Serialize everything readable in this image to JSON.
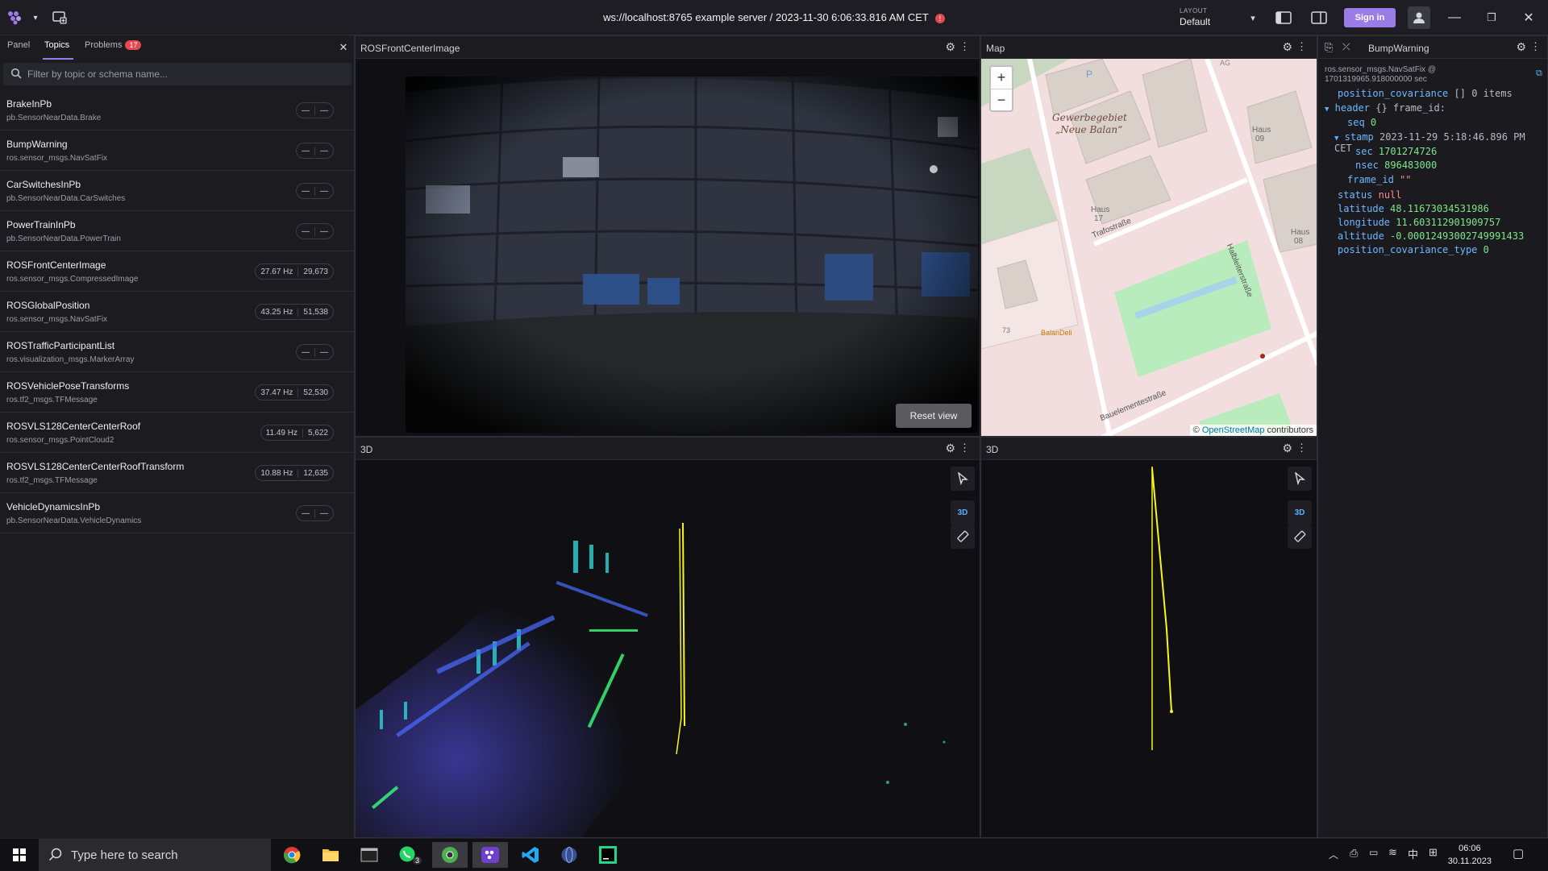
{
  "app": {
    "title": "ws://localhost:8765 example server / 2023-11-30 6:06:33.816 AM CET",
    "error_indicator": "!",
    "layout_label": "LAYOUT",
    "layout_value": "Default",
    "signin_label": "Sign in"
  },
  "sidebar": {
    "tabs": [
      {
        "label": "Panel"
      },
      {
        "label": "Topics"
      },
      {
        "label": "Problems",
        "badge": "17"
      }
    ],
    "filter_placeholder": "Filter by topic or schema name...",
    "topics": [
      {
        "name": "BrakeInPb",
        "schema": "pb.SensorNearData.Brake",
        "hz": "—",
        "count": "—"
      },
      {
        "name": "BumpWarning",
        "schema": "ros.sensor_msgs.NavSatFix",
        "hz": "—",
        "count": "—"
      },
      {
        "name": "CarSwitchesInPb",
        "schema": "pb.SensorNearData.CarSwitches",
        "hz": "—",
        "count": "—"
      },
      {
        "name": "PowerTrainInPb",
        "schema": "pb.SensorNearData.PowerTrain",
        "hz": "—",
        "count": "—"
      },
      {
        "name": "ROSFrontCenterImage",
        "schema": "ros.sensor_msgs.CompressedImage",
        "hz": "27.67 Hz",
        "count": "29,673"
      },
      {
        "name": "ROSGlobalPosition",
        "schema": "ros.sensor_msgs.NavSatFix",
        "hz": "43.25 Hz",
        "count": "51,538"
      },
      {
        "name": "ROSTrafficParticipantList",
        "schema": "ros.visualization_msgs.MarkerArray",
        "hz": "—",
        "count": "—"
      },
      {
        "name": "ROSVehiclePoseTransforms",
        "schema": "ros.tf2_msgs.TFMessage",
        "hz": "37.47 Hz",
        "count": "52,530"
      },
      {
        "name": "ROSVLS128CenterCenterRoof",
        "schema": "ros.sensor_msgs.PointCloud2",
        "hz": "11.49 Hz",
        "count": "5,622"
      },
      {
        "name": "ROSVLS128CenterCenterRoofTransform",
        "schema": "ros.tf2_msgs.TFMessage",
        "hz": "10.88 Hz",
        "count": "12,635"
      },
      {
        "name": "VehicleDynamicsInPb",
        "schema": "pb.SensorNearData.VehicleDynamics",
        "hz": "—",
        "count": "—"
      }
    ]
  },
  "panels": {
    "image": {
      "title": "ROSFrontCenterImage",
      "reset_label": "Reset view"
    },
    "map": {
      "title": "Map",
      "zoom_in": "+",
      "zoom_out": "−",
      "attribution_prefix": "© ",
      "attribution_link": "OpenStreetMap",
      "attribution_suffix": " contributors",
      "labels": {
        "area": "Gewerbegebiet",
        "area2": "„Neue Balan“",
        "haus09a": "Haus",
        "haus09b": "09",
        "haus17a": "Haus",
        "haus17b": "17",
        "haus08a": "Haus",
        "haus08b": "08",
        "street1": "Trafostraße",
        "street2": "Halbleiterstraße",
        "street3": "Bauelementestraße",
        "poi": "BalanDeli",
        "num": "73",
        "parking": "P",
        "ag": "AG"
      }
    },
    "raw": {
      "title": "BumpWarning",
      "schema_line1": "ros.sensor_msgs.NavSatFix @",
      "schema_line2": "1701319965.918000000 sec",
      "position_covariance_key": "position_covariance",
      "position_covariance_val": "[] 0 items",
      "header_key": "header",
      "header_val": "{} frame_id:",
      "seq_key": "seq",
      "seq_val": "0",
      "stamp_key": "stamp",
      "stamp_val": "2023-11-29 5:18:46.896 PM CET",
      "sec_key": "sec",
      "sec_val": "1701274726",
      "nsec_key": "nsec",
      "nsec_val": "896483000",
      "frame_id_key": "frame_id",
      "frame_id_val": "\"\"",
      "status_key": "status",
      "status_val": "null",
      "latitude_key": "latitude",
      "latitude_val": "48.11673034531986",
      "longitude_key": "longitude",
      "longitude_val": "11.603112901909757",
      "altitude_key": "altitude",
      "altitude_val": "-0.00012493002749991433",
      "pct_key": "position_covariance_type",
      "pct_val": "0"
    },
    "threeD_left": {
      "title": "3D",
      "tool_3d": "3D"
    },
    "threeD_right": {
      "title": "3D",
      "tool_3d": "3D"
    }
  },
  "taskbar": {
    "search_placeholder": "Type here to search",
    "whatsapp_badge": "3",
    "time": "06:06",
    "date": "30.11.2023"
  }
}
